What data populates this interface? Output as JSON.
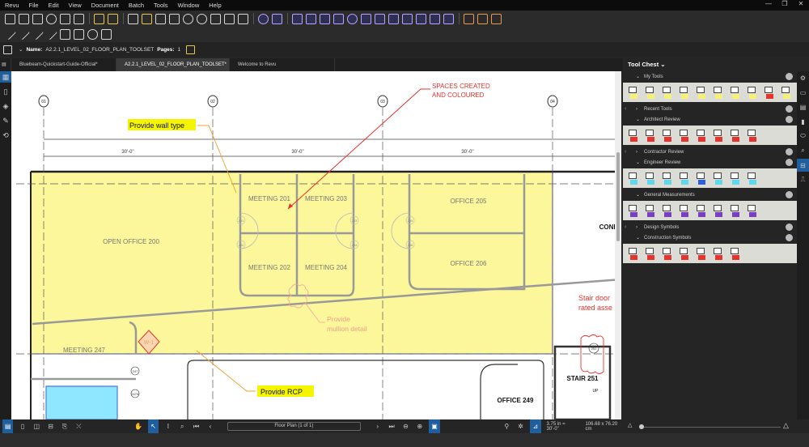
{
  "menubar": {
    "items": [
      "Revu",
      "File",
      "Edit",
      "View",
      "Document",
      "Batch",
      "Tools",
      "Window",
      "Help"
    ]
  },
  "window_controls": [
    "minimize",
    "restore",
    "close"
  ],
  "window_glyphs": [
    "—",
    "❐",
    "✕"
  ],
  "toolbar1": [
    "new-document",
    "open",
    "save",
    "print",
    "email",
    "split-view",
    "sep",
    "import",
    "export",
    "sep",
    "text-box",
    "highlight",
    "pen",
    "callout",
    "cloud",
    "cloud-plus",
    "stamp",
    "snapshot",
    "crop",
    "sep",
    "rotate",
    "properties",
    "sep",
    "length",
    "area",
    "perimeter",
    "volume",
    "diameter",
    "angle",
    "count",
    "polylength",
    "radius",
    "polygon",
    "arc",
    "fill",
    "sep",
    "compare",
    "overlay",
    "spaces"
  ],
  "toolbar2": [
    "line",
    "arrow",
    "arc",
    "polyline",
    "dimension",
    "rectangle",
    "ellipse",
    "polygon"
  ],
  "propbar": {
    "name_label": "Name:",
    "name_value": "A2.2.1_LEVEL_02_FLOOR_PLAN_TOOLSET",
    "pages_label": "Pages:",
    "pages_value": "1"
  },
  "tabs": [
    {
      "label": "Bluebeam-Quickstart-Guide-Official*"
    },
    {
      "label": "A2.2.1_LEVEL_02_FLOOR_PLAN_TOOLSET*",
      "close": "✕"
    },
    {
      "label": "Welcome to Revu"
    }
  ],
  "drawing": {
    "grid_bubbles": [
      "01",
      "02",
      "03",
      "04"
    ],
    "dimensions": [
      "30'-0\"",
      "30'-0\"",
      "30'-0\""
    ],
    "rooms": {
      "open_office": "OPEN OFFICE  200",
      "meeting_201": "MEETING  201",
      "meeting_203": "MEETING  203",
      "meeting_202": "MEETING  202",
      "meeting_204": "MEETING  204",
      "office_205": "OFFICE  205",
      "office_206": "OFFICE  206",
      "meeting_247": "MEETING  247",
      "stair_251": "STAIR 251",
      "office_249": "OFFICE  249",
      "conf": "CONF",
      "up": "UP"
    },
    "door_tags": [
      "201",
      "202",
      "203",
      "204",
      "205",
      "206",
      "247",
      "247A",
      "251"
    ],
    "wall_tag": "W-1",
    "callouts": {
      "wall_type": "Provide wall type",
      "rcp": "Provide RCP",
      "spaces_line1": "SPACES CREATED",
      "spaces_line2": "AND COLOURED",
      "mullion_line1": "Provide",
      "mullion_line2": "mullion detail",
      "stair_line1": "Stair door",
      "stair_line2": "rated asse"
    },
    "colors": {
      "space_fill": "#fbf79a",
      "markup_red": "#e8322b",
      "highlight": "#f5f500",
      "leader": "#f0a030",
      "blue_space": "#8fe6ff"
    }
  },
  "statusbar": {
    "page_nav": "Floor Plan (1 of 1)",
    "scale": "3.75 in = 30'-0\"",
    "size": "106.68 x 76.20 cm"
  },
  "tool_chest": {
    "title": "Tool Chest",
    "sections": [
      {
        "label": "My Tools",
        "expanded": true,
        "tools": [
          "highlight",
          "text-box",
          "pen",
          "arrow",
          "callout",
          "cloud",
          "ellipse",
          "rectangle",
          "fill-red",
          "area-polygon"
        ]
      },
      {
        "label": "Recent Tools",
        "expanded": false,
        "tools": []
      },
      {
        "label": "Architect Review",
        "expanded": true,
        "tools": [
          "cloud-callout",
          "text-box",
          "highlight-red",
          "arrow",
          "stamp-red",
          "cloud",
          "callout",
          "dimension"
        ]
      },
      {
        "label": "Contractor Review",
        "expanded": false,
        "tools": []
      },
      {
        "label": "Engineer Review",
        "expanded": true,
        "tools": [
          "cloud-callout",
          "text-box",
          "highlight-cyan",
          "dimension",
          "stamp-blue",
          "cloud",
          "callout",
          "polyline"
        ]
      },
      {
        "label": "General Measurements",
        "expanded": true,
        "tools": [
          "area",
          "length",
          "perimeter",
          "volume",
          "count",
          "check",
          "angle",
          "diameter"
        ]
      },
      {
        "label": "Design Symbols",
        "expanded": false,
        "tools": []
      },
      {
        "label": "Construction Symbols",
        "expanded": true,
        "tools": [
          "door",
          "sprinkler",
          "hourglass",
          "panel",
          "bowtie",
          "valve",
          "sign"
        ]
      }
    ]
  }
}
